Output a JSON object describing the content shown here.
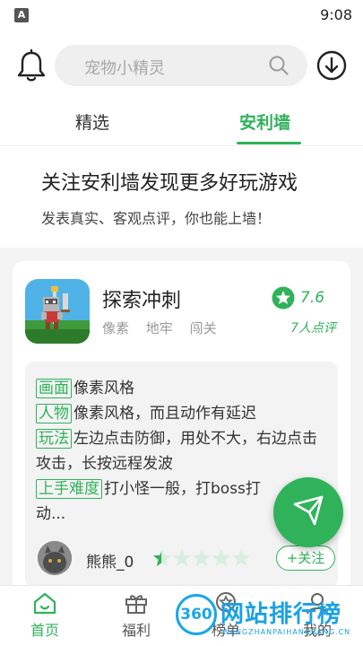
{
  "status_bar": {
    "notification_icon": "A",
    "time": "9:08"
  },
  "header": {
    "search_placeholder": "宠物小精灵"
  },
  "tabs": [
    {
      "label": "精选",
      "active": false
    },
    {
      "label": "安利墙",
      "active": true
    }
  ],
  "intro": {
    "title": "关注安利墙发现更多好玩游戏",
    "subtitle": "发表真实、客观点评，你也能上墙！"
  },
  "game": {
    "name": "探索冲刺",
    "tags": [
      "像素",
      "地牢",
      "闯关"
    ],
    "rating": "7.6",
    "rating_count": "7人点评"
  },
  "review": {
    "items": [
      {
        "tag": "画面",
        "text": "像素风格"
      },
      {
        "tag": "人物",
        "text": "像素风格，而且动作有延迟"
      },
      {
        "tag": "玩法",
        "text": "左边点击防御，用处不大，右边点击攻击，长按远程发波"
      },
      {
        "tag": "上手难度",
        "text": "打小怪一般，打boss打"
      }
    ],
    "truncated": "动..."
  },
  "reviewer": {
    "name": "熊熊_0",
    "star_rating": 0.5,
    "star_total": 5,
    "follow_label": "+关注"
  },
  "nav": [
    {
      "label": "首页",
      "icon": "home-icon",
      "active": true
    },
    {
      "label": "福利",
      "icon": "gift-icon",
      "active": false
    },
    {
      "label": "榜单",
      "icon": "trophy-icon",
      "active": false
    },
    {
      "label": "我的",
      "icon": "user-icon",
      "active": false
    }
  ],
  "watermark": {
    "badge": "360",
    "title": "网站排行榜",
    "subtitle": "WANGZHANPAIHANGBANG.CN"
  },
  "colors": {
    "accent": "#2fb25a",
    "watermark": "#1aa1e6"
  }
}
